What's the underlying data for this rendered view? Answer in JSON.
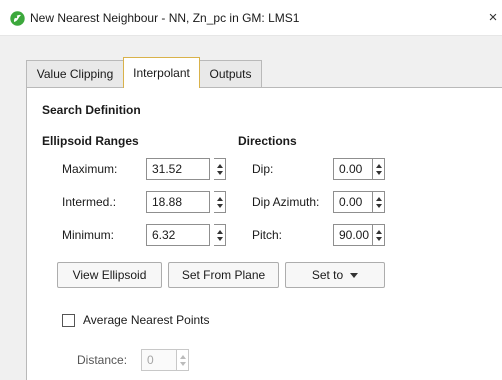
{
  "window": {
    "title": "New Nearest Neighbour - NN, Zn_pc in GM: LMS1",
    "close_glyph": "×",
    "app_icon": "leapfrog-app-icon"
  },
  "tabs": [
    {
      "label": "Value Clipping",
      "active": false
    },
    {
      "label": "Interpolant",
      "active": true
    },
    {
      "label": "Outputs",
      "active": false
    }
  ],
  "search_definition": {
    "heading": "Search Definition",
    "ellipsoid_ranges": {
      "heading": "Ellipsoid Ranges",
      "maximum": {
        "label": "Maximum:",
        "value": "31.52"
      },
      "intermed": {
        "label": "Intermed.:",
        "value": "18.88"
      },
      "minimum": {
        "label": "Minimum:",
        "value": "6.32"
      }
    },
    "directions": {
      "heading": "Directions",
      "dip": {
        "label": "Dip:",
        "value": "0.00"
      },
      "dip_azimuth": {
        "label": "Dip Azimuth:",
        "value": "0.00"
      },
      "pitch": {
        "label": "Pitch:",
        "value": "90.00"
      }
    },
    "buttons": {
      "view_ellipsoid": "View Ellipsoid",
      "set_from_plane": "Set From Plane",
      "set_to": "Set to"
    }
  },
  "average_nearest_points": {
    "label": "Average Nearest Points",
    "checked": false,
    "distance": {
      "label": "Distance:",
      "value": "0",
      "disabled": true
    }
  },
  "colors": {
    "active_tab_border": "#d9b24a",
    "app_icon_green": "#3ca83c"
  }
}
